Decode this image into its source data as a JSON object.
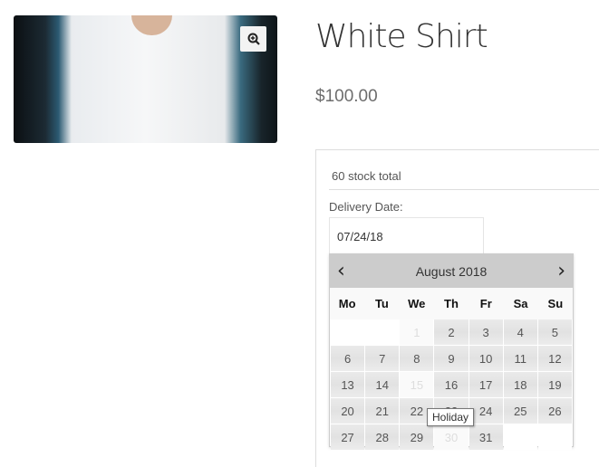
{
  "product": {
    "title": "White Shirt",
    "price": "$100.00",
    "image_zoom_icon": "zoom-in-icon"
  },
  "stock": "60 stock total",
  "delivery": {
    "label": "Delivery Date:",
    "value": "07/24/18"
  },
  "calendar": {
    "month": "August 2018",
    "prev": "‹",
    "next": "›",
    "weekdays": [
      "Mo",
      "Tu",
      "We",
      "Th",
      "Fr",
      "Sa",
      "Su"
    ],
    "leading_empty": 2,
    "days": 31,
    "disabled_days": [
      1,
      15,
      30
    ]
  },
  "tooltip": "Holiday"
}
